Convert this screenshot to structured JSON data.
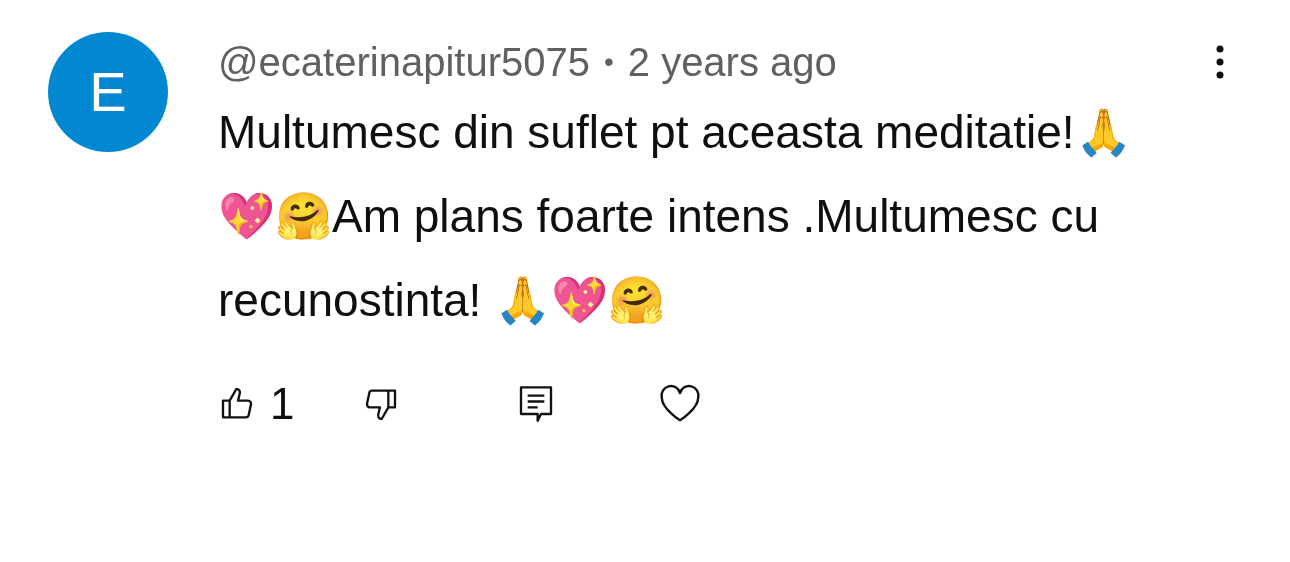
{
  "comment": {
    "avatar_letter": "E",
    "author": "@ecaterinapitur5075",
    "separator": "•",
    "time": "2 years ago",
    "text": "Multumesc din suflet pt aceasta meditatie!🙏💖🤗Am plans foarte intens .Multumesc cu recunostinta! 🙏💖🤗",
    "like_count": "1"
  }
}
